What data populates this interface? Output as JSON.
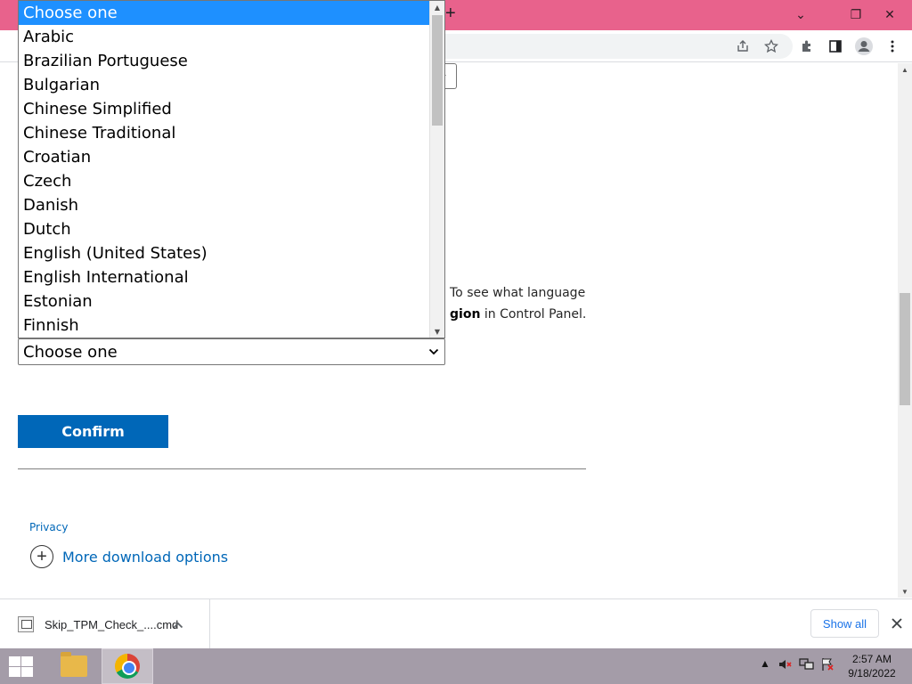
{
  "browser": {
    "new_tab_glyph": "+",
    "window_controls": {
      "minimize": "⌄",
      "restore": "❐",
      "close": "✕"
    }
  },
  "toolbar": {
    "icons": [
      "share-icon",
      "star-icon",
      "extensions-icon",
      "sidepanel-icon",
      "profile-icon",
      "menu-icon"
    ]
  },
  "page": {
    "info_text_prefix": "To see what language",
    "info_text_bold": "gion",
    "info_text_suffix": " in Control Panel.",
    "language_select_value": "Choose one",
    "confirm_label": "Confirm",
    "privacy_label": "Privacy",
    "more_options_label": "More download options"
  },
  "dropdown": {
    "options": [
      "Choose one",
      "Arabic",
      "Brazilian Portuguese",
      "Bulgarian",
      "Chinese Simplified",
      "Chinese Traditional",
      "Croatian",
      "Czech",
      "Danish",
      "Dutch",
      "English (United States)",
      "English International",
      "Estonian",
      "Finnish"
    ],
    "selected_index": 0,
    "selected_color": "#1e90ff"
  },
  "downloads": {
    "file_name": "Skip_TPM_Check_....cmd",
    "show_all_label": "Show all"
  },
  "taskbar": {
    "time": "2:57 AM",
    "date": "9/18/2022",
    "color": "#a49ca8"
  },
  "colors": {
    "titlebar": "#e8628c",
    "accent": "#0067b8"
  }
}
